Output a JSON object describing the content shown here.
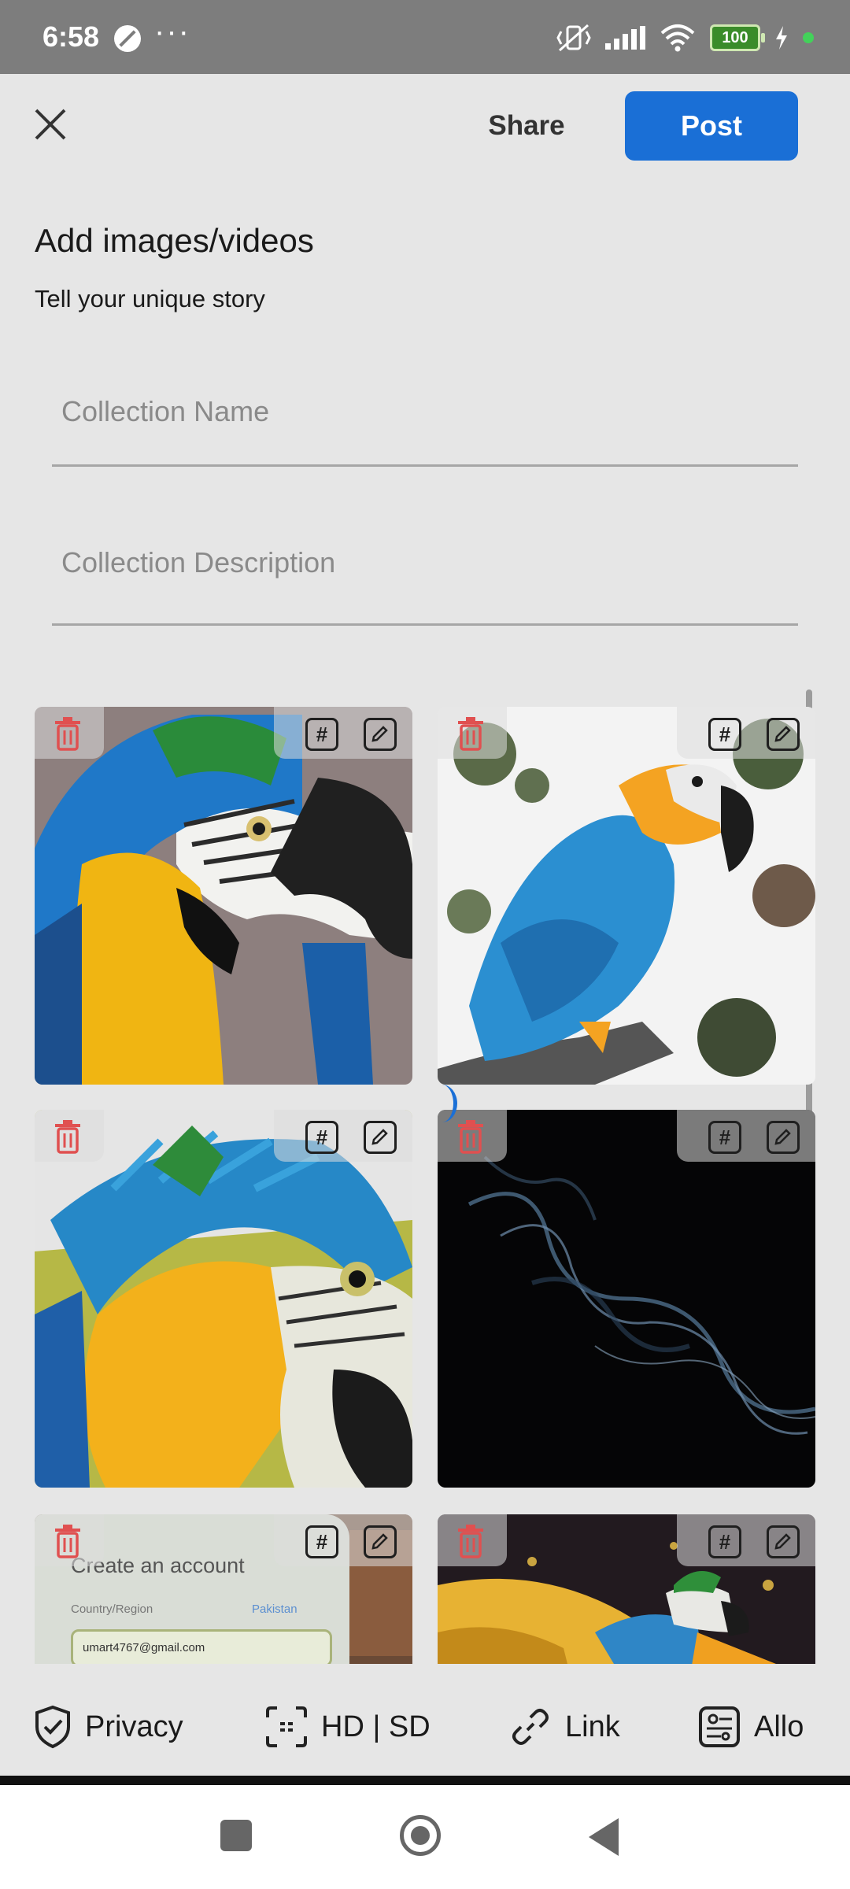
{
  "status_bar": {
    "time": "6:58",
    "dots": "···",
    "battery": "100",
    "accent_green": "#43d15a"
  },
  "header": {
    "share_label": "Share",
    "post_label": "Post",
    "post_color": "#1a6fd6"
  },
  "form": {
    "title": "Add images/videos",
    "subtitle": "Tell your unique story",
    "collection_name_placeholder": "Collection Name",
    "collection_description_placeholder": "Collection Description"
  },
  "media": {
    "tag_symbol": "#",
    "tiles": [
      {
        "id": "parrot-closeup"
      },
      {
        "id": "parrot-branch"
      },
      {
        "id": "parrot-feathers"
      },
      {
        "id": "smoke-dark"
      },
      {
        "id": "screenshot-create-account",
        "text": "Create an account",
        "region_label": "Country/Region",
        "region_value": "Pakistan",
        "email": "umart4767@gmail.com"
      },
      {
        "id": "parrot-flying"
      }
    ]
  },
  "options": {
    "privacy": "Privacy",
    "quality": "HD | SD",
    "link": "Link",
    "allow": "Allo"
  }
}
